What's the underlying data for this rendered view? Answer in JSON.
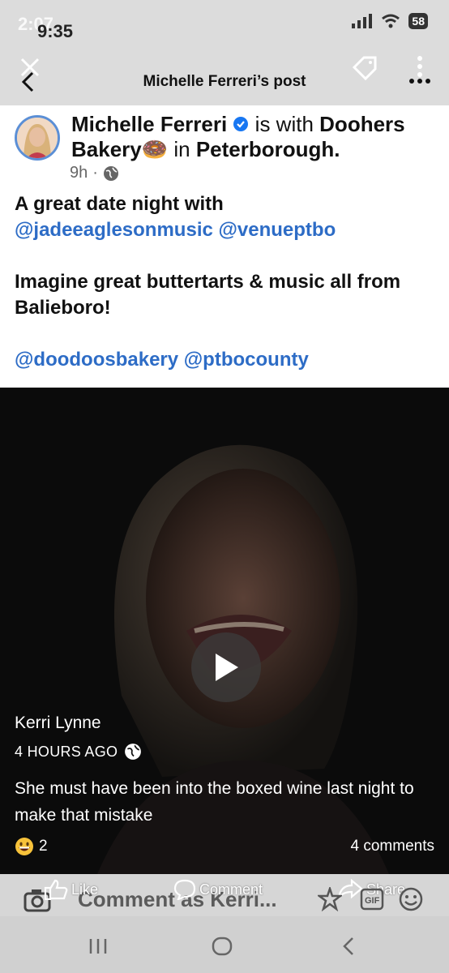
{
  "status": {
    "time_back": "2:07",
    "time_front": "9:35",
    "battery": "58"
  },
  "header": {
    "title": "Michelle Ferreri’s post"
  },
  "post": {
    "author": "Michelle Ferreri",
    "with_text": "is with",
    "tagged_page": "Doohers Bakery",
    "location_prefix": "in",
    "location": "Peterborough.",
    "time": "9h",
    "line1": "A great date night with",
    "mention1": "@jadeeaglesonmusic",
    "mention2": "@venueptbo",
    "line2": "Imagine great buttertarts & music all from Balieboro!",
    "mention3": "@doodoosbakery",
    "mention4": "@ptbocounty"
  },
  "video_comment": {
    "author": "Kerri Lynne",
    "time": "4 HOURS AGO",
    "text": "She must have been into the boxed wine last night to make that mistake",
    "reaction_count": "2",
    "comments_count": "4 comments"
  },
  "actions": {
    "like": "Like",
    "comment": "Comment",
    "share": "Share",
    "comment_as": "Comment as Kerri..."
  },
  "icons": {
    "back": "back-arrow-icon",
    "close": "close-icon",
    "tag": "tag-icon",
    "more": "more-dots-icon",
    "verified": "verified-badge-icon",
    "globe": "globe-icon"
  }
}
